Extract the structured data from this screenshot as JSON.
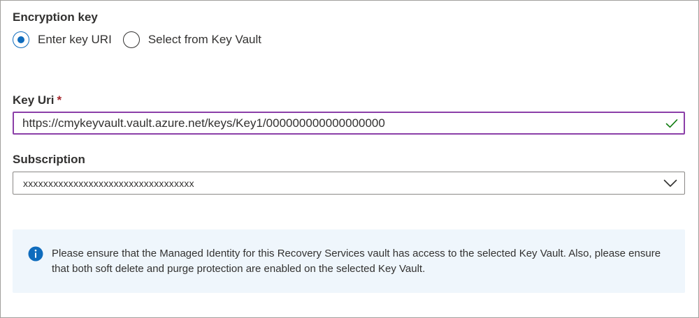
{
  "encryption_key": {
    "title": "Encryption key",
    "options": [
      {
        "label": "Enter key URI",
        "selected": true
      },
      {
        "label": "Select from Key Vault",
        "selected": false
      }
    ]
  },
  "key_uri": {
    "label": "Key Uri",
    "required_marker": "*",
    "value": "https://cmykeyvault.vault.azure.net/keys/Key1/000000000000000000",
    "valid": true
  },
  "subscription": {
    "label": "Subscription",
    "selected_value": "xxxxxxxxxxxxxxxxxxxxxxxxxxxxxxxxxx"
  },
  "info": {
    "icon": "info-icon",
    "message": "Please ensure that the Managed Identity for this Recovery Services vault has access to the selected Key Vault. Also, please ensure that both soft delete and purge protection are enabled on the selected Key Vault."
  },
  "colors": {
    "accent": "#0f6cbd",
    "input_focus_border": "#8b3fa8",
    "success": "#107c10",
    "required": "#a4262c",
    "info_bg": "#eff6fc"
  }
}
